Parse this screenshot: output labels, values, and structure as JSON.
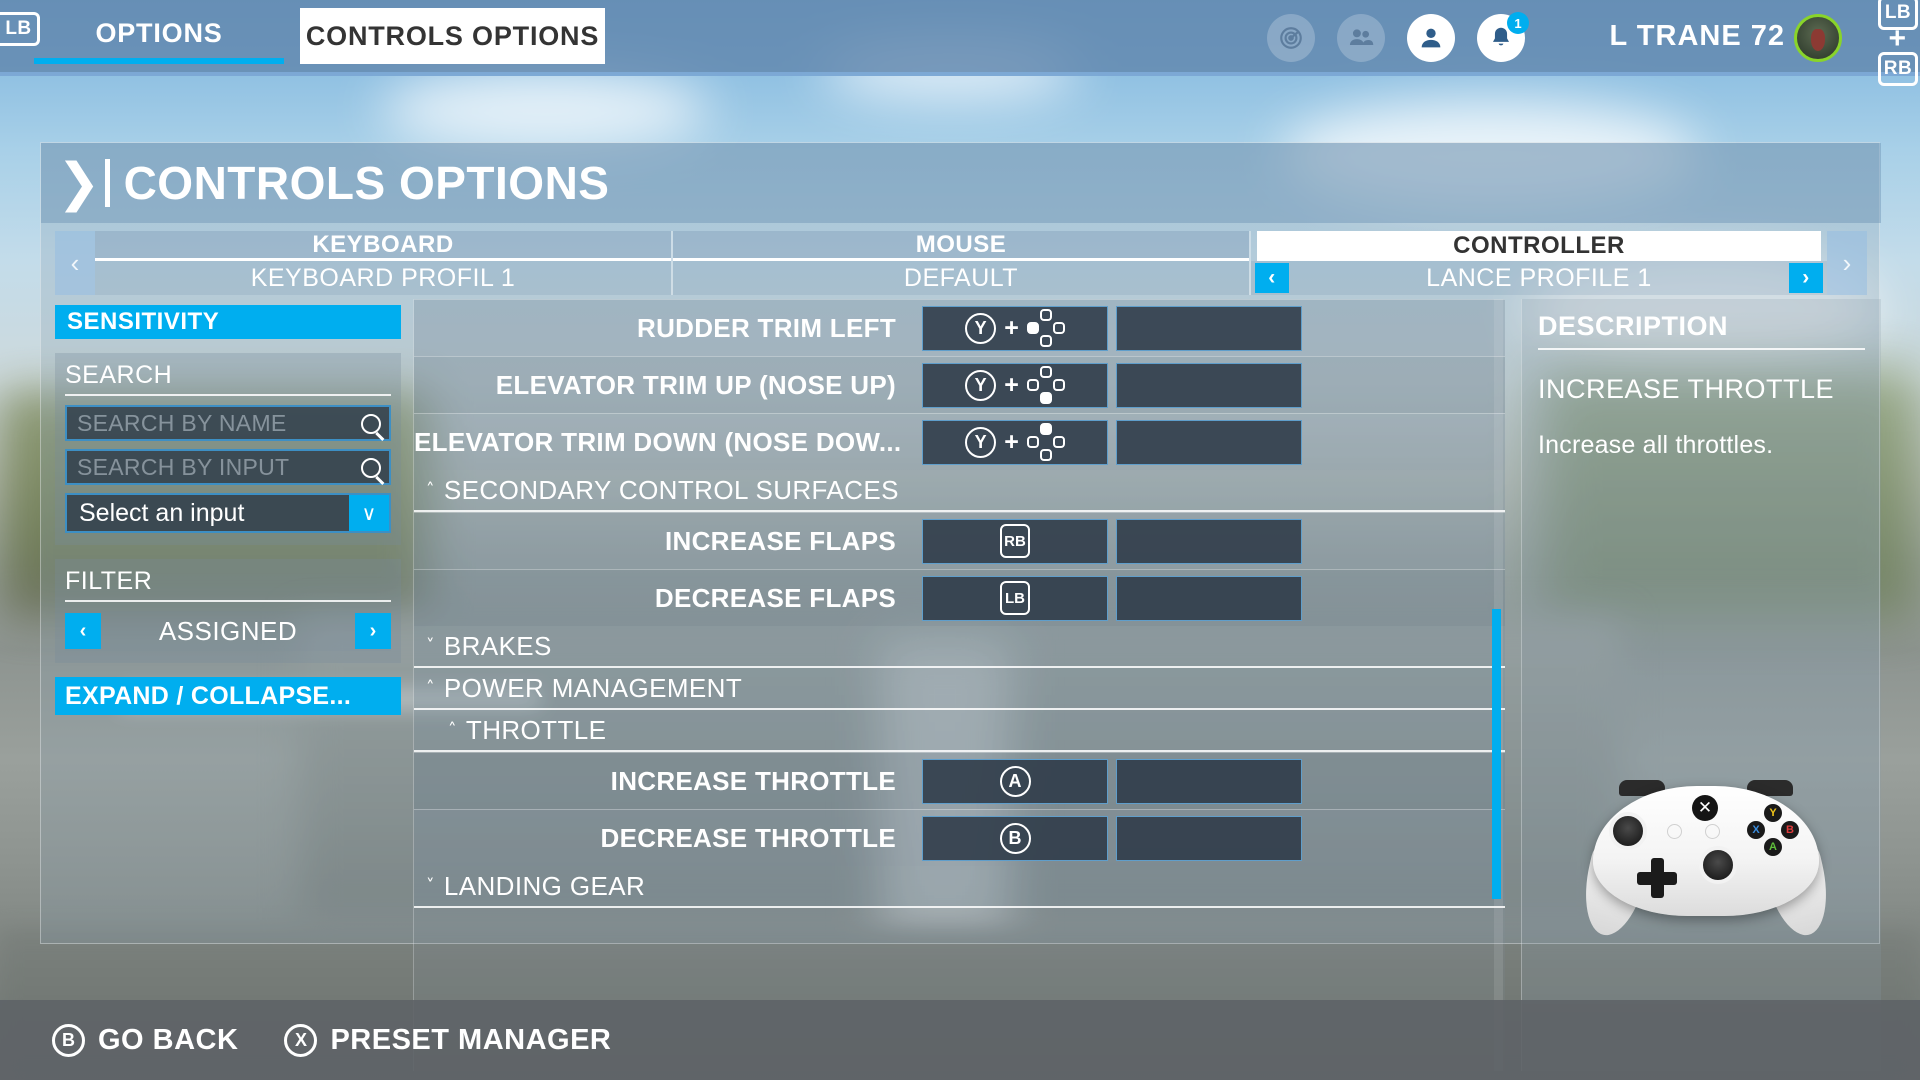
{
  "topbar": {
    "lb_left_label": "LB",
    "lb_right_label": "LB",
    "plus_label": "+",
    "rb_right_label": "RB",
    "tabs": [
      {
        "label": "OPTIONS",
        "active": false
      },
      {
        "label": "CONTROLS OPTIONS",
        "active": true
      }
    ],
    "icons": [
      {
        "name": "radar-icon",
        "glyph": "◎"
      },
      {
        "name": "friends-icon",
        "glyph": "👥"
      },
      {
        "name": "profile-icon",
        "glyph": "👤"
      },
      {
        "name": "notifications-icon",
        "glyph": "🔔"
      }
    ],
    "notification_count": "1",
    "username": "L TRANE 72"
  },
  "page": {
    "title": "CONTROLS OPTIONS",
    "chevron": "❯",
    "nav_prev": "‹",
    "nav_next": "›"
  },
  "devices": [
    {
      "name": "KEYBOARD",
      "profile": "KEYBOARD PROFIL 1",
      "active": false
    },
    {
      "name": "MOUSE",
      "profile": "DEFAULT",
      "active": false
    },
    {
      "name": "CONTROLLER",
      "profile": "LANCE PROFILE 1",
      "active": true
    }
  ],
  "sidebar": {
    "sensitivity_label": "SENSITIVITY",
    "search_label": "SEARCH",
    "search_by_name_placeholder": "SEARCH BY NAME",
    "search_by_name_value": "",
    "search_by_input_placeholder": "SEARCH BY INPUT",
    "search_by_input_value": "",
    "select_input_value": "Select an input",
    "filter_label": "FILTER",
    "filter_value": "ASSIGNED",
    "expand_collapse_label": "EXPAND / COLLAPSE...",
    "prev_glyph": "‹",
    "next_glyph": "›",
    "caret_glyph": "∨"
  },
  "bindings": [
    {
      "type": "binding",
      "name": "RUDDER TRIM LEFT",
      "primary": {
        "parts": [
          {
            "kind": "button",
            "label": "Y"
          },
          {
            "kind": "plus"
          },
          {
            "kind": "dpad",
            "dir": "left"
          }
        ]
      },
      "secondary": {
        "parts": []
      }
    },
    {
      "type": "binding",
      "name": "ELEVATOR TRIM UP (NOSE UP)",
      "primary": {
        "parts": [
          {
            "kind": "button",
            "label": "Y"
          },
          {
            "kind": "plus"
          },
          {
            "kind": "dpad",
            "dir": "down"
          }
        ]
      },
      "secondary": {
        "parts": []
      }
    },
    {
      "type": "binding",
      "name": "ELEVATOR TRIM DOWN (NOSE DOW...",
      "primary": {
        "parts": [
          {
            "kind": "button",
            "label": "Y"
          },
          {
            "kind": "plus"
          },
          {
            "kind": "dpad",
            "dir": "up"
          }
        ]
      },
      "secondary": {
        "parts": []
      }
    },
    {
      "type": "group",
      "name": "SECONDARY CONTROL SURFACES",
      "level": 1,
      "expanded": true,
      "caret": "˄"
    },
    {
      "type": "binding",
      "name": "INCREASE FLAPS",
      "primary": {
        "parts": [
          {
            "kind": "bumper",
            "label": "RB"
          }
        ]
      },
      "secondary": {
        "parts": []
      }
    },
    {
      "type": "binding",
      "name": "DECREASE FLAPS",
      "primary": {
        "parts": [
          {
            "kind": "bumper",
            "label": "LB"
          }
        ]
      },
      "secondary": {
        "parts": []
      }
    },
    {
      "type": "group",
      "name": "BRAKES",
      "level": 1,
      "expanded": false,
      "caret": "˅"
    },
    {
      "type": "group",
      "name": "POWER MANAGEMENT",
      "level": 1,
      "expanded": true,
      "caret": "˄"
    },
    {
      "type": "group",
      "name": "THROTTLE",
      "level": 2,
      "expanded": true,
      "caret": "˄"
    },
    {
      "type": "binding",
      "name": "INCREASE THROTTLE",
      "primary": {
        "parts": [
          {
            "kind": "button",
            "label": "A"
          }
        ]
      },
      "secondary": {
        "parts": []
      }
    },
    {
      "type": "binding",
      "name": "DECREASE THROTTLE",
      "primary": {
        "parts": [
          {
            "kind": "button",
            "label": "B"
          }
        ]
      },
      "secondary": {
        "parts": []
      }
    },
    {
      "type": "group",
      "name": "LANDING GEAR",
      "level": 1,
      "expanded": false,
      "caret": "˅"
    }
  ],
  "description": {
    "title": "DESCRIPTION",
    "binding_name": "INCREASE THROTTLE",
    "text": "Increase all throttles."
  },
  "controller_art": {
    "name": "xbox-controller-image",
    "guide_glyph": "✕",
    "buttons": {
      "y": "Y",
      "x": "X",
      "b": "B",
      "a": "A"
    }
  },
  "bottombar": [
    {
      "glyph": "B",
      "label": "GO BACK",
      "name": "go-back-hint"
    },
    {
      "glyph": "X",
      "label": "PRESET MANAGER",
      "name": "preset-manager-hint"
    }
  ],
  "colors": {
    "accent": "#00aeef",
    "panel_dark": "#2d3a48",
    "white": "#ffffff"
  }
}
